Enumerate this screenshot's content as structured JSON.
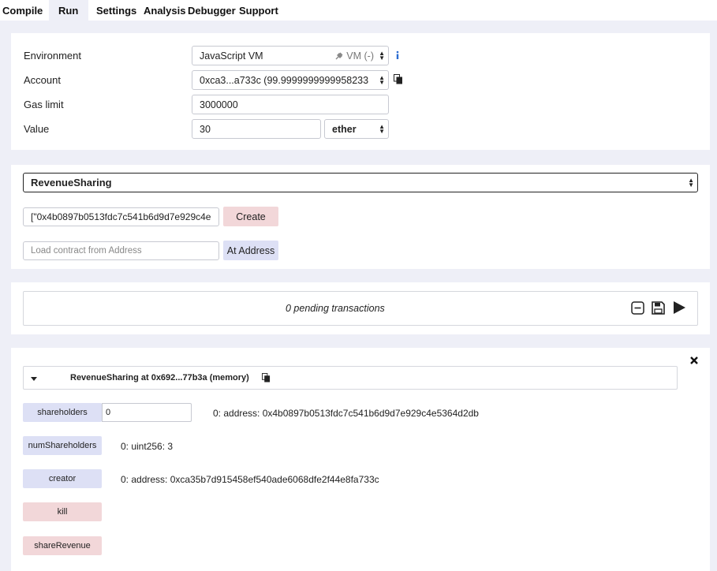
{
  "tabs": [
    "Compile",
    "Run",
    "Settings",
    "Analysis",
    "Debugger",
    "Support"
  ],
  "settings": {
    "environment_label": "Environment",
    "environment_value": "JavaScript VM",
    "environment_badge": "VM (-)",
    "account_label": "Account",
    "account_value": "0xca3...a733c (99.9999999999958233",
    "gas_label": "Gas limit",
    "gas_value": "3000000",
    "value_label": "Value",
    "value_value": "30",
    "value_unit": "ether"
  },
  "contract": {
    "selected": "RevenueSharing",
    "constructor_args": "[\"0x4b0897b0513fdc7c541b6d9d7e929c4e",
    "create_label": "Create",
    "address_placeholder": "Load contract from Address",
    "at_address_label": "At Address"
  },
  "pending": {
    "text": "0 pending transactions"
  },
  "instance": {
    "title": "RevenueSharing at 0x692...77b3a (memory)",
    "functions": [
      {
        "label": "shareholders",
        "input": "0",
        "output": "0: address: 0x4b0897b0513fdc7c541b6d9d7e929c4e5364d2db"
      },
      {
        "label": "numShareholders",
        "output": "0: uint256: 3"
      },
      {
        "label": "creator",
        "output": "0: address: 0xca35b7d915458ef540ade6068dfe2f44e8fa733c"
      },
      {
        "label": "kill"
      },
      {
        "label": "shareRevenue"
      }
    ]
  },
  "colors": {
    "accent_red": "#f2d7d9",
    "accent_blue": "#dde0f5",
    "background": "#eeeff7"
  },
  "icons": [
    "plug-icon",
    "info-icon",
    "copy-icon",
    "collapse-icon",
    "save-icon",
    "play-icon",
    "close-icon",
    "caret-down-icon"
  ]
}
